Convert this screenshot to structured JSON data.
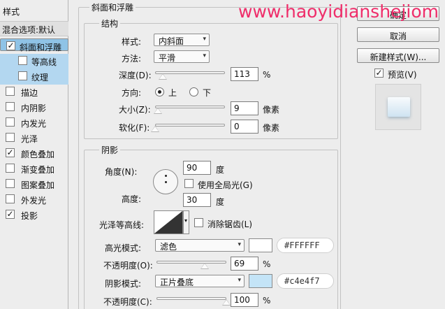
{
  "left_panel": {
    "title": "样式",
    "blend_options": "混合选项:默认",
    "items": [
      {
        "label": "斜面和浮雕",
        "checked": true
      },
      {
        "label": "等高线",
        "checked": false
      },
      {
        "label": "纹理",
        "checked": false
      },
      {
        "label": "描边",
        "checked": false
      },
      {
        "label": "内阴影",
        "checked": false
      },
      {
        "label": "内发光",
        "checked": false
      },
      {
        "label": "光泽",
        "checked": false
      },
      {
        "label": "颜色叠加",
        "checked": true
      },
      {
        "label": "渐变叠加",
        "checked": false
      },
      {
        "label": "图案叠加",
        "checked": false
      },
      {
        "label": "外发光",
        "checked": false
      },
      {
        "label": "投影",
        "checked": true
      }
    ]
  },
  "bevel": {
    "section_title": "斜面和浮雕",
    "structure_title": "结构",
    "style_label": "样式:",
    "style_value": "内斜面",
    "method_label": "方法:",
    "method_value": "平滑",
    "depth_label": "深度(D):",
    "depth_value": "113",
    "depth_unit": "%",
    "direction_label": "方向:",
    "direction_up": "上",
    "direction_down": "下",
    "size_label": "大小(Z):",
    "size_value": "9",
    "size_unit": "像素",
    "soften_label": "软化(F):",
    "soften_value": "0",
    "soften_unit": "像素"
  },
  "shading": {
    "title": "阴影",
    "angle_label": "角度(N):",
    "angle_value": "90",
    "angle_unit": "度",
    "global_light_label": "使用全局光(G)",
    "altitude_label": "高度:",
    "altitude_value": "30",
    "altitude_unit": "度",
    "gloss_contour_label": "光泽等高线:",
    "anti_alias_label": "消除锯齿(L)",
    "highlight_mode_label": "高光模式:",
    "highlight_mode_value": "滤色",
    "highlight_color": "#FFFFFF",
    "highlight_hex": "#FFFFFF",
    "highlight_opacity_label": "不透明度(O):",
    "highlight_opacity_value": "69",
    "highlight_opacity_unit": "%",
    "shadow_mode_label": "阴影模式:",
    "shadow_mode_value": "正片叠底",
    "shadow_color": "#c4e4f7",
    "shadow_hex": "#c4e4f7",
    "shadow_opacity_label": "不透明度(C):",
    "shadow_opacity_value": "100",
    "shadow_opacity_unit": "%"
  },
  "right_panel": {
    "ok": "确定",
    "cancel": "取消",
    "new_style": "新建样式(W)...",
    "preview_label": "预览(V)",
    "preview_checked": true
  },
  "watermark": "www.haoyidianshejiom",
  "levels": {
    "depth_slider": 0.113,
    "size_slider": 0.036,
    "soften_slider": 0.0,
    "highlight_opacity_slider": 0.69,
    "shadow_opacity_slider": 1.0
  },
  "icons": {
    "check": "✓",
    "dropdown": "▾"
  }
}
